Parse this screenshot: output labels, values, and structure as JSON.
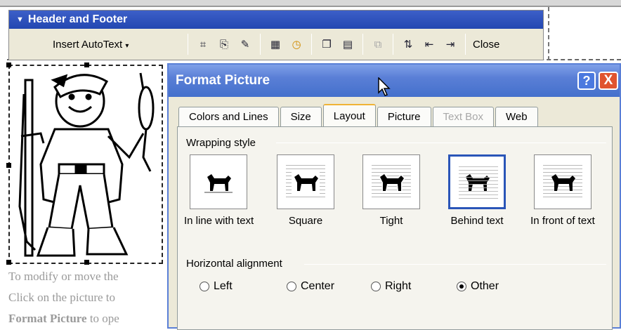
{
  "toolbar": {
    "title": "Header and Footer",
    "insert_autotext": "Insert AutoText",
    "close_label": "Close"
  },
  "document": {
    "line1": "To modify or move the",
    "line2": "Click on the picture to",
    "line3_bold": "Format Picture",
    "line3_rest": " to ope"
  },
  "dialog": {
    "title": "Format Picture",
    "help_label": "?",
    "close_label": "X",
    "tabs": [
      {
        "label": "Colors and Lines",
        "state": "normal"
      },
      {
        "label": "Size",
        "state": "normal"
      },
      {
        "label": "Layout",
        "state": "active"
      },
      {
        "label": "Picture",
        "state": "normal"
      },
      {
        "label": "Text Box",
        "state": "disabled"
      },
      {
        "label": "Web",
        "state": "normal"
      }
    ],
    "wrapping_style_label": "Wrapping style",
    "wrapping_options": [
      {
        "label": "In line with text",
        "selected": false
      },
      {
        "label": "Square",
        "selected": false
      },
      {
        "label": "Tight",
        "selected": false
      },
      {
        "label": "Behind text",
        "selected": true
      },
      {
        "label": "In front of text",
        "selected": false
      }
    ],
    "horizontal_alignment_label": "Horizontal alignment",
    "alignment_options": [
      {
        "label": "Left",
        "checked": false
      },
      {
        "label": "Center",
        "checked": false
      },
      {
        "label": "Right",
        "checked": false
      },
      {
        "label": "Other",
        "checked": true
      }
    ]
  },
  "colors": {
    "titlebar": "#5a7fd6",
    "toolbar_title": "#2347b1",
    "selected_border": "#2a55b8",
    "active_tab_accent": "#f0b336"
  }
}
